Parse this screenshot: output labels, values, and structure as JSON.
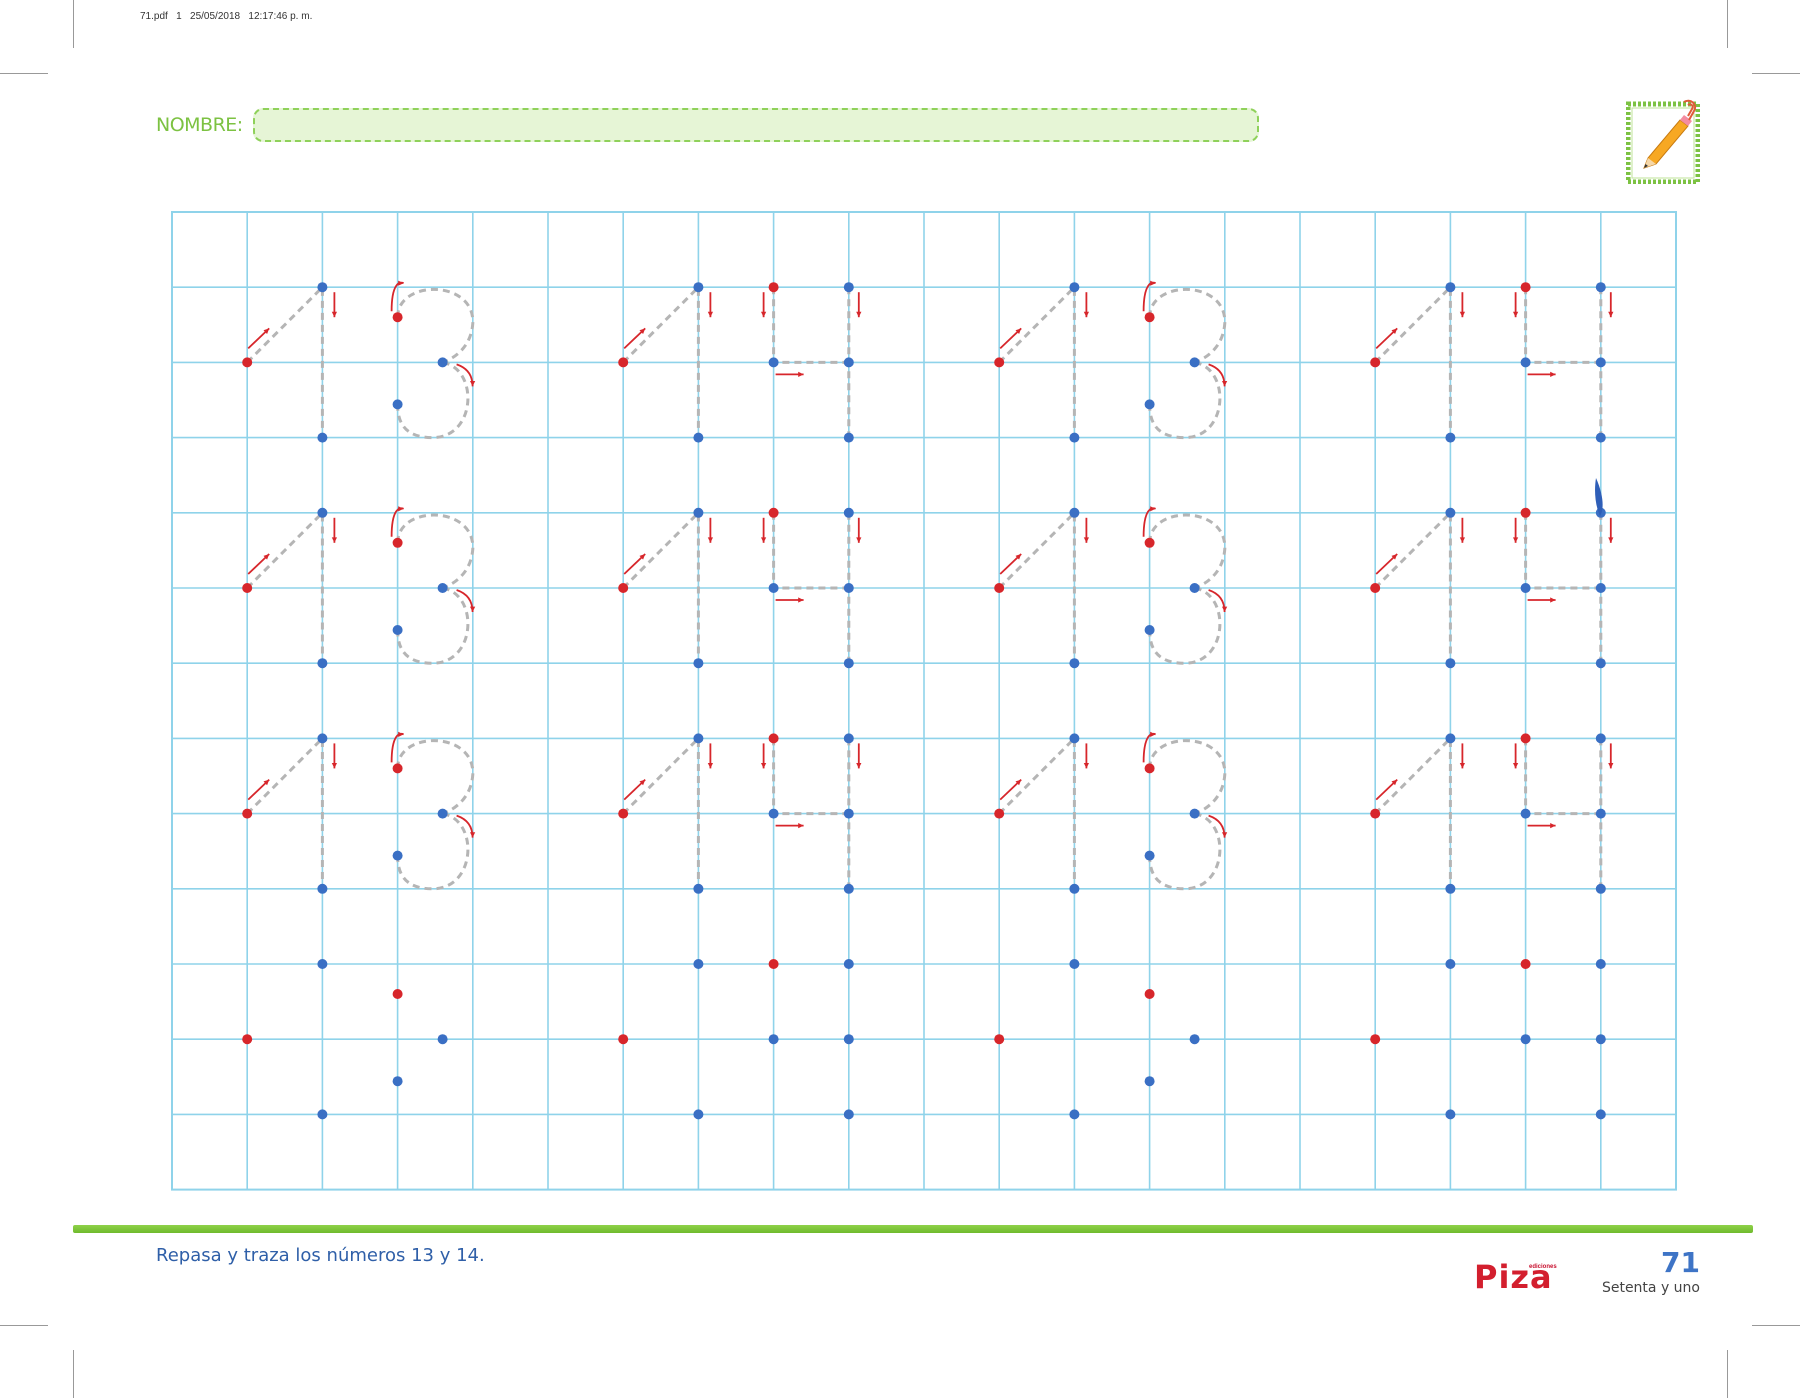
{
  "print_header": "71.pdf   1   25/05/2018   12:17:46 p. m.",
  "name_label": "NOMBRE:",
  "name_field": {
    "value": "",
    "placeholder": ""
  },
  "instruction": "Repasa y traza los números 13 y 14.",
  "brand": {
    "sub": "ediciones",
    "name": "Piza"
  },
  "page_number": "71",
  "page_number_words": "Setenta y uno",
  "colors": {
    "grid_line": "#8fd3ea",
    "start_dot": "#d7262b",
    "point_dot": "#3a6fc4",
    "dashed_trace": "#b5b5b5",
    "arrow": "#d7262b",
    "accent_green": "#7cc242",
    "text_blue": "#2f5fa8"
  },
  "grid": {
    "columns": 20,
    "rows": 13
  },
  "number_rows": [
    {
      "digits": [
        "13",
        "14",
        "13",
        "14"
      ],
      "traced": true
    },
    {
      "digits": [
        "13",
        "14",
        "13",
        "14"
      ],
      "traced": true
    },
    {
      "digits": [
        "13",
        "14",
        "13",
        "14"
      ],
      "traced": true
    },
    {
      "digits": [
        "13",
        "14",
        "13",
        "14"
      ],
      "traced": false
    }
  ],
  "icons": [
    "pencil-icon",
    "paperclip-icon"
  ]
}
